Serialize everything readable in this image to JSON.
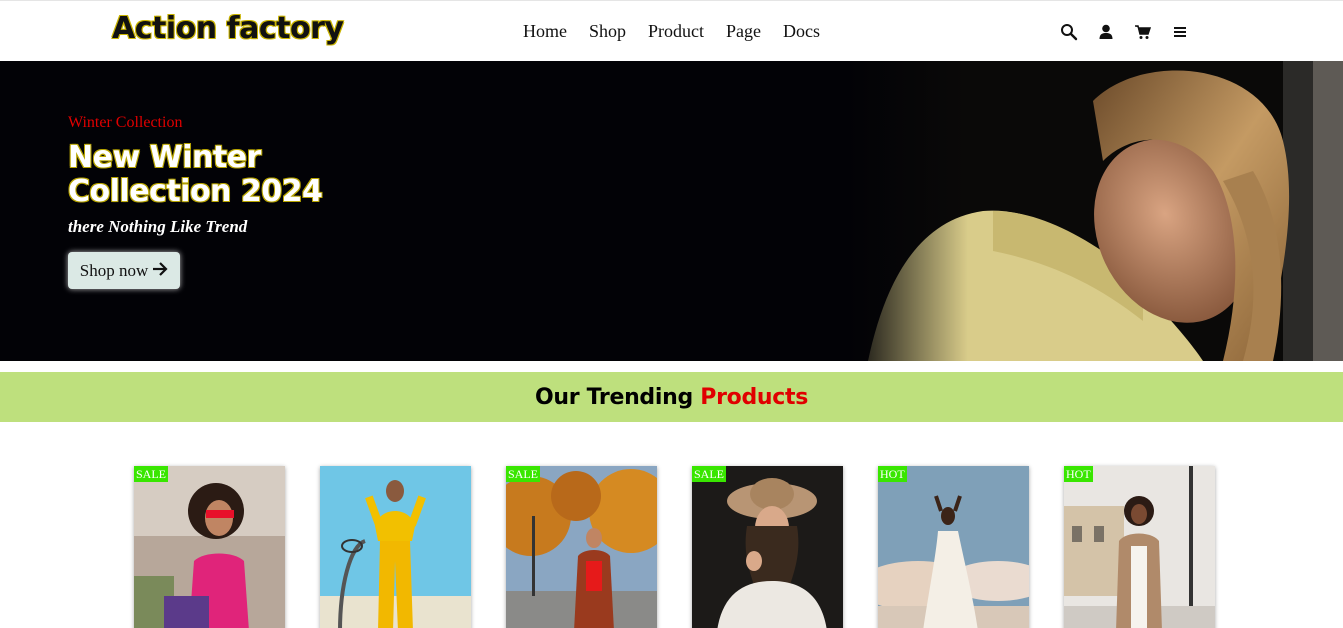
{
  "header": {
    "logo": "Action factory",
    "nav": [
      "Home",
      "Shop",
      "Product",
      "Page",
      "Docs"
    ],
    "icons": [
      "search-icon",
      "user-icon",
      "cart-icon",
      "menu-icon"
    ]
  },
  "hero": {
    "eyebrow": "Winter Collection",
    "title": "New Winter Collection 2024",
    "subtitle": "there Nothing Like Trend",
    "button_label": "Shop now"
  },
  "trending": {
    "title_prefix": "Our Trending",
    "title_accent": "Products"
  },
  "products": [
    {
      "badge": "SALE"
    },
    {
      "badge": ""
    },
    {
      "badge": "SALE"
    },
    {
      "badge": "SALE"
    },
    {
      "badge": "HOT"
    },
    {
      "badge": "HOT"
    }
  ],
  "colors": {
    "accent_red": "#e00000",
    "band_green": "#bee07d",
    "badge_green": "#39e600",
    "hero_bg": "#020206"
  }
}
